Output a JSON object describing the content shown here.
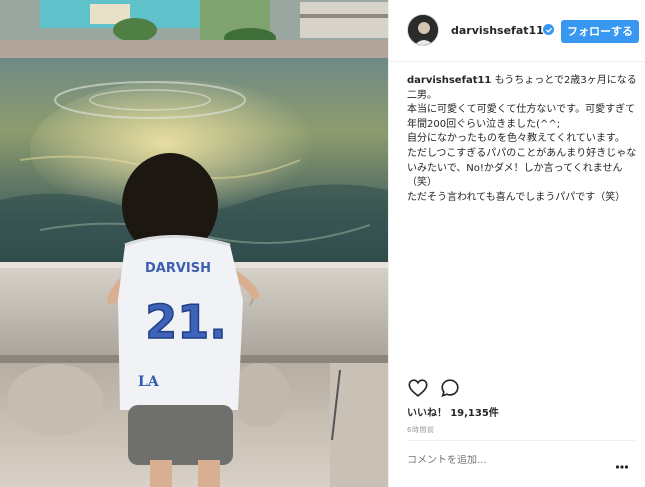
{
  "post": {
    "username": "darvishsefat11",
    "follow_label": "フォローする",
    "caption": {
      "author": "darvishsefat11",
      "text": " もうちょっとで2歳3ヶ月になる二男。\n本当に可愛くて可愛くて仕方ないです。可愛すぎて年間200回ぐらい泣きました(^^;\n自分になかったものを色々教えてくれています。\nただしつこすぎるパパのことがあんまり好きじゃないみたいで、No!かダメ！しか言ってくれません（笑）\nただそう言われても喜んでしまうパパです（笑）"
    },
    "likes_label": "いいね！",
    "likes_count": "19,135件",
    "time_ago": "6時間前",
    "comment_placeholder": "コメントを追加..."
  },
  "photo": {
    "shirt_text": "DARVISH",
    "shirt_number": "21."
  },
  "icons": {
    "verified": "verified-badge-icon",
    "like": "heart-icon",
    "comment": "comment-bubble-icon",
    "more": "more-dots-icon"
  },
  "colors": {
    "accent": "#3897f0",
    "text": "#262626",
    "muted": "#999999",
    "border": "#efefef"
  }
}
